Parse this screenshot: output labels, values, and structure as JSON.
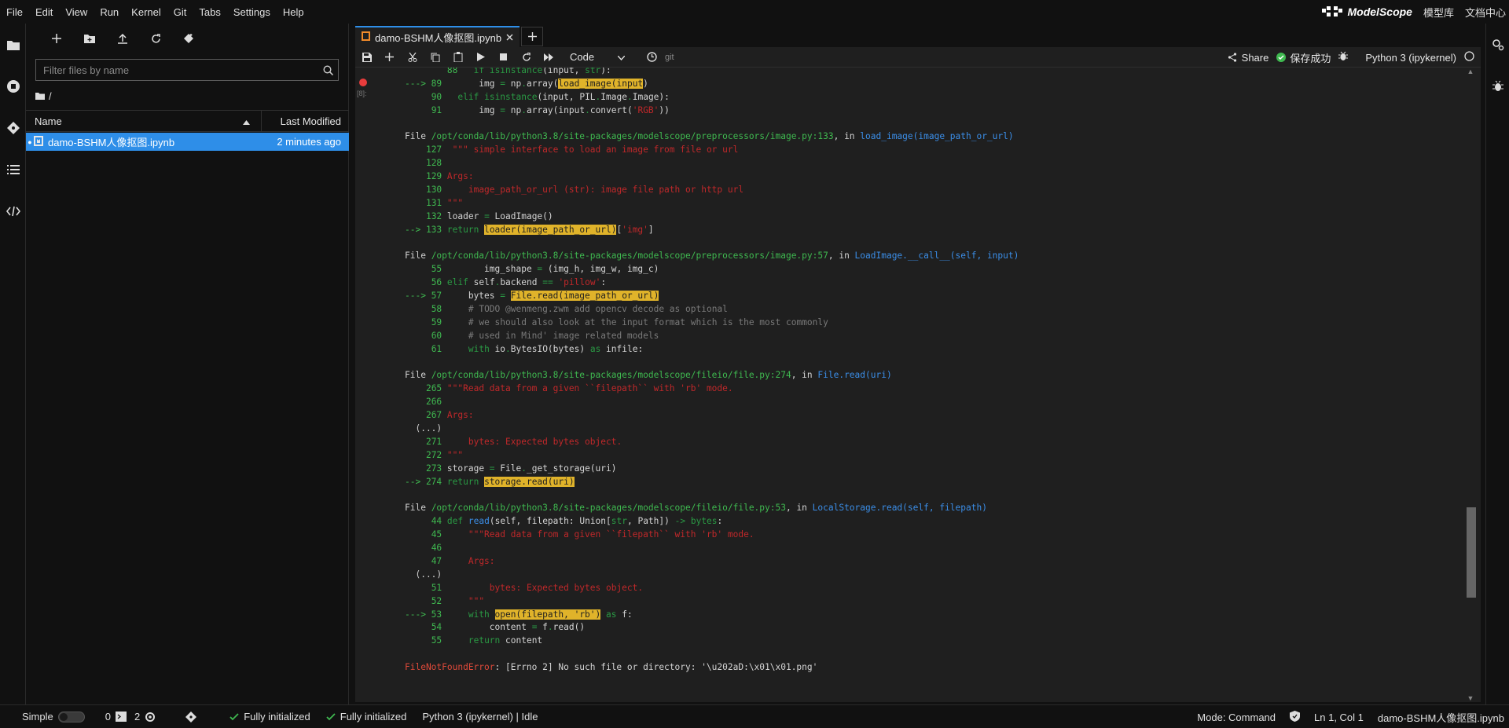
{
  "menu": [
    "File",
    "Edit",
    "View",
    "Run",
    "Kernel",
    "Git",
    "Tabs",
    "Settings",
    "Help"
  ],
  "brand": {
    "logo": "ModelScope",
    "links": [
      "模型库",
      "文档中心"
    ]
  },
  "filebrowser": {
    "search_placeholder": "Filter files by name",
    "breadcrumb": "/",
    "col_name": "Name",
    "col_modified": "Last Modified",
    "files": [
      {
        "name": "damo-BSHM人像抠图.ipynb",
        "modified": "2 minutes ago"
      }
    ]
  },
  "tab": {
    "title": "damo-BSHM人像抠图.ipynb"
  },
  "toolbar": {
    "cell_type": "Code",
    "git_label": "git",
    "share": "Share",
    "save_status": "保存成功",
    "kernel": "Python 3 (ipykernel)"
  },
  "gutter": {
    "exec_count": "[8]:"
  },
  "output_lines": [
    [
      [
        "t",
        "        "
      ],
      [
        "num",
        "88"
      ],
      [
        "t",
        "   "
      ],
      [
        "kw",
        "if"
      ],
      [
        "t",
        " "
      ],
      [
        "bi",
        "isinstance"
      ],
      [
        "t",
        "(input, "
      ],
      [
        "bi",
        "str"
      ],
      [
        "t",
        "):"
      ]
    ],
    [
      [
        "arrow",
        "---> 89"
      ],
      [
        "t",
        "       img "
      ],
      [
        "kw",
        "="
      ],
      [
        "t",
        " np"
      ],
      [
        "kw",
        "."
      ],
      [
        "t",
        "array("
      ],
      [
        "hl",
        "load_image("
      ],
      [
        "hl",
        "input"
      ],
      [
        "t",
        ")"
      ]
    ],
    [
      [
        "t",
        "     "
      ],
      [
        "num",
        "90"
      ],
      [
        "t",
        "   "
      ],
      [
        "kw",
        "elif"
      ],
      [
        "t",
        " "
      ],
      [
        "bi",
        "isinstance"
      ],
      [
        "t",
        "(input, PIL"
      ],
      [
        "kw",
        "."
      ],
      [
        "t",
        "Image"
      ],
      [
        "kw",
        "."
      ],
      [
        "t",
        "Image):"
      ]
    ],
    [
      [
        "t",
        "     "
      ],
      [
        "num",
        "91"
      ],
      [
        "t",
        "       img "
      ],
      [
        "kw",
        "="
      ],
      [
        "t",
        " np"
      ],
      [
        "kw",
        "."
      ],
      [
        "t",
        "array(input"
      ],
      [
        "kw",
        "."
      ],
      [
        "t",
        "convert("
      ],
      [
        "str",
        "'RGB'"
      ],
      [
        "t",
        "))"
      ]
    ],
    [
      [
        "t",
        ""
      ]
    ],
    [
      [
        "file",
        "File "
      ],
      [
        "path",
        "/opt/conda/lib/python3.8/site-packages/modelscope/preprocessors/image.py:133"
      ],
      [
        "t",
        ", in "
      ],
      [
        "func",
        "load_image(image_path_or_url)"
      ]
    ],
    [
      [
        "t",
        "    "
      ],
      [
        "num",
        "127"
      ],
      [
        "str",
        "  \"\"\" simple interface to load an image from file or url"
      ]
    ],
    [
      [
        "t",
        "    "
      ],
      [
        "num",
        "128"
      ]
    ],
    [
      [
        "t",
        "    "
      ],
      [
        "num",
        "129"
      ],
      [
        "str",
        " Args:"
      ]
    ],
    [
      [
        "t",
        "    "
      ],
      [
        "num",
        "130"
      ],
      [
        "str",
        "     image_path_or_url (str): image file path or http url"
      ]
    ],
    [
      [
        "t",
        "    "
      ],
      [
        "num",
        "131"
      ],
      [
        "str",
        " \"\"\""
      ]
    ],
    [
      [
        "t",
        "    "
      ],
      [
        "num",
        "132"
      ],
      [
        "t",
        " loader "
      ],
      [
        "kw",
        "="
      ],
      [
        "t",
        " LoadImage()"
      ]
    ],
    [
      [
        "arrow",
        "--> 133"
      ],
      [
        "t",
        " "
      ],
      [
        "kw",
        "return"
      ],
      [
        "t",
        " "
      ],
      [
        "hl",
        "loader(image_path_or_url)"
      ],
      [
        "t",
        "["
      ],
      [
        "str",
        "'img'"
      ],
      [
        "t",
        "]"
      ]
    ],
    [
      [
        "t",
        ""
      ]
    ],
    [
      [
        "file",
        "File "
      ],
      [
        "path",
        "/opt/conda/lib/python3.8/site-packages/modelscope/preprocessors/image.py:57"
      ],
      [
        "t",
        ", in "
      ],
      [
        "func",
        "LoadImage.__call__"
      ],
      [
        "func",
        "(self, input)"
      ]
    ],
    [
      [
        "t",
        "     "
      ],
      [
        "num",
        "55"
      ],
      [
        "t",
        "        img_shape "
      ],
      [
        "kw",
        "="
      ],
      [
        "t",
        " (img_h, img_w, img_c)"
      ]
    ],
    [
      [
        "t",
        "     "
      ],
      [
        "num",
        "56"
      ],
      [
        "t",
        " "
      ],
      [
        "kw",
        "elif"
      ],
      [
        "t",
        " self"
      ],
      [
        "kw",
        "."
      ],
      [
        "t",
        "backend "
      ],
      [
        "kw",
        "=="
      ],
      [
        "t",
        " "
      ],
      [
        "str",
        "'pillow'"
      ],
      [
        "t",
        ":"
      ]
    ],
    [
      [
        "arrow",
        "---> 57"
      ],
      [
        "t",
        "     bytes "
      ],
      [
        "kw",
        "="
      ],
      [
        "t",
        " "
      ],
      [
        "hl",
        "File.read(image_path_or_url)"
      ]
    ],
    [
      [
        "t",
        "     "
      ],
      [
        "num",
        "58"
      ],
      [
        "t",
        "     "
      ],
      [
        "dim",
        "# TODO @wenmeng.zwm add opencv decode as optional"
      ]
    ],
    [
      [
        "t",
        "     "
      ],
      [
        "num",
        "59"
      ],
      [
        "t",
        "     "
      ],
      [
        "dim",
        "# we should also look at the input format which is the most commonly"
      ]
    ],
    [
      [
        "t",
        "     "
      ],
      [
        "num",
        "60"
      ],
      [
        "t",
        "     "
      ],
      [
        "dim",
        "# used in Mind' image related models"
      ]
    ],
    [
      [
        "t",
        "     "
      ],
      [
        "num",
        "61"
      ],
      [
        "t",
        "     "
      ],
      [
        "kw",
        "with"
      ],
      [
        "t",
        " io"
      ],
      [
        "kw",
        "."
      ],
      [
        "t",
        "BytesIO(bytes) "
      ],
      [
        "kw",
        "as"
      ],
      [
        "t",
        " infile:"
      ]
    ],
    [
      [
        "t",
        ""
      ]
    ],
    [
      [
        "file",
        "File "
      ],
      [
        "path",
        "/opt/conda/lib/python3.8/site-packages/modelscope/fileio/file.py:274"
      ],
      [
        "t",
        ", in "
      ],
      [
        "func",
        "File.read"
      ],
      [
        "func",
        "(uri)"
      ]
    ],
    [
      [
        "t",
        "    "
      ],
      [
        "num",
        "265"
      ],
      [
        "str",
        " \"\"\"Read data from a given ``filepath`` with 'rb' mode."
      ]
    ],
    [
      [
        "t",
        "    "
      ],
      [
        "num",
        "266"
      ]
    ],
    [
      [
        "t",
        "    "
      ],
      [
        "num",
        "267"
      ],
      [
        "str",
        " Args:"
      ]
    ],
    [
      [
        "t",
        "  (...)"
      ]
    ],
    [
      [
        "t",
        "    "
      ],
      [
        "num",
        "271"
      ],
      [
        "str",
        "     bytes: Expected bytes object."
      ]
    ],
    [
      [
        "t",
        "    "
      ],
      [
        "num",
        "272"
      ],
      [
        "str",
        " \"\"\""
      ]
    ],
    [
      [
        "t",
        "    "
      ],
      [
        "num",
        "273"
      ],
      [
        "t",
        " storage "
      ],
      [
        "kw",
        "="
      ],
      [
        "t",
        " File"
      ],
      [
        "kw",
        "."
      ],
      [
        "t",
        "_get_storage(uri)"
      ]
    ],
    [
      [
        "arrow",
        "--> 274"
      ],
      [
        "t",
        " "
      ],
      [
        "kw",
        "return"
      ],
      [
        "t",
        " "
      ],
      [
        "hl",
        "storage.read(uri)"
      ]
    ],
    [
      [
        "t",
        ""
      ]
    ],
    [
      [
        "file",
        "File "
      ],
      [
        "path",
        "/opt/conda/lib/python3.8/site-packages/modelscope/fileio/file.py:53"
      ],
      [
        "t",
        ", in "
      ],
      [
        "func",
        "LocalStorage.read"
      ],
      [
        "func",
        "(self, filepath)"
      ]
    ],
    [
      [
        "t",
        "     "
      ],
      [
        "num",
        "44"
      ],
      [
        "t",
        " "
      ],
      [
        "kw",
        "def"
      ],
      [
        "t",
        " "
      ],
      [
        "func",
        "read"
      ],
      [
        "t",
        "(self, filepath: Union["
      ],
      [
        "bi",
        "str"
      ],
      [
        "t",
        ", Path]) "
      ],
      [
        "kw",
        "->"
      ],
      [
        "t",
        " "
      ],
      [
        "bi",
        "bytes"
      ],
      [
        "t",
        ":"
      ]
    ],
    [
      [
        "t",
        "     "
      ],
      [
        "num",
        "45"
      ],
      [
        "str",
        "     \"\"\"Read data from a given ``filepath`` with 'rb' mode."
      ]
    ],
    [
      [
        "t",
        "     "
      ],
      [
        "num",
        "46"
      ]
    ],
    [
      [
        "t",
        "     "
      ],
      [
        "num",
        "47"
      ],
      [
        "str",
        "     Args:"
      ]
    ],
    [
      [
        "t",
        "  (...)"
      ]
    ],
    [
      [
        "t",
        "     "
      ],
      [
        "num",
        "51"
      ],
      [
        "str",
        "         bytes: Expected bytes object."
      ]
    ],
    [
      [
        "t",
        "     "
      ],
      [
        "num",
        "52"
      ],
      [
        "str",
        "     \"\"\""
      ]
    ],
    [
      [
        "arrow",
        "---> 53"
      ],
      [
        "t",
        "     "
      ],
      [
        "kw",
        "with"
      ],
      [
        "t",
        " "
      ],
      [
        "hl",
        "open(filepath, 'rb')"
      ],
      [
        "t",
        " "
      ],
      [
        "kw",
        "as"
      ],
      [
        "t",
        " f:"
      ]
    ],
    [
      [
        "t",
        "     "
      ],
      [
        "num",
        "54"
      ],
      [
        "t",
        "         content "
      ],
      [
        "kw",
        "="
      ],
      [
        "t",
        " f"
      ],
      [
        "kw",
        "."
      ],
      [
        "t",
        "read()"
      ]
    ],
    [
      [
        "t",
        "     "
      ],
      [
        "num",
        "55"
      ],
      [
        "t",
        "     "
      ],
      [
        "kw",
        "return"
      ],
      [
        "t",
        " content"
      ]
    ],
    [
      [
        "t",
        ""
      ]
    ],
    [
      [
        "err",
        "FileNotFoundError"
      ],
      [
        "t",
        ": [Errno 2] No such file or directory: '\\u202aD:\\x01\\x01.png'"
      ]
    ]
  ],
  "statusbar": {
    "mode_label": "Simple",
    "terminals": "0",
    "kernels": "2",
    "init1": "Fully initialized",
    "init2": "Fully initialized",
    "kernel_status": "Python 3 (ipykernel) | Idle",
    "mode": "Mode: Command",
    "cursor": "Ln 1, Col 1",
    "filename": "damo-BSHM人像抠图.ipynb"
  },
  "colors": {
    "accent": "#2e8ee8",
    "highlight": "#e0b32a",
    "error": "#e83c3c",
    "path": "#3fb950"
  }
}
